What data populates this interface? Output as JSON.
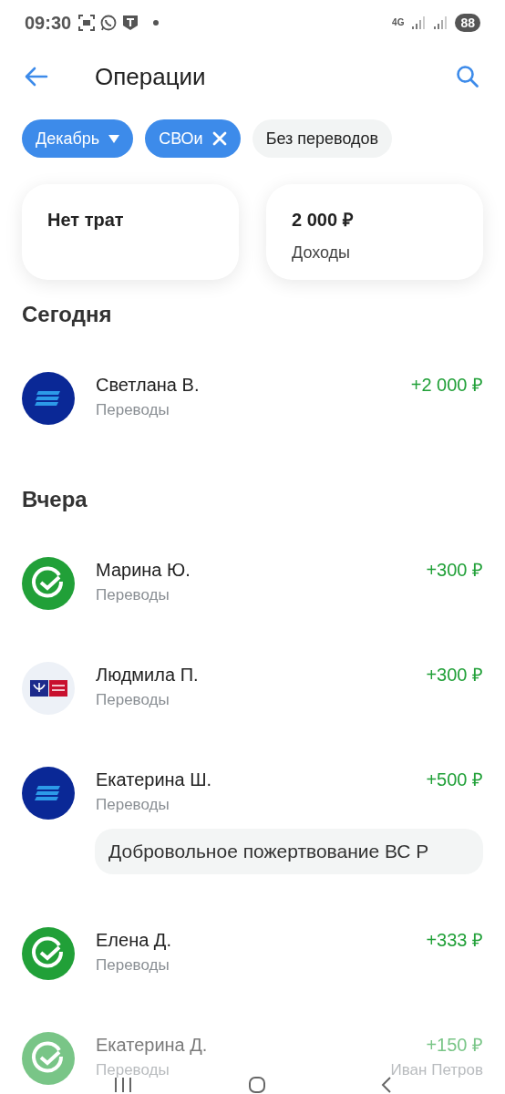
{
  "status_bar": {
    "time": "09:30",
    "network": "4G",
    "battery": "88"
  },
  "header": {
    "title": "Операции"
  },
  "filters": [
    {
      "label": "Декабрь",
      "kind": "dropdown",
      "selected": true
    },
    {
      "label": "СВОи",
      "kind": "removable",
      "selected": true
    },
    {
      "label": "Без переводов",
      "kind": "toggle",
      "selected": false
    }
  ],
  "summary": [
    {
      "value": "Нет трат"
    },
    {
      "value": "2 000 ₽",
      "caption": "Доходы"
    }
  ],
  "sections": [
    {
      "title": "Сегодня",
      "operations": [
        {
          "name": "Светлана В.",
          "category": "Переводы",
          "amount": "+2 000 ₽",
          "kind": "vtb",
          "faded": false
        }
      ]
    },
    {
      "title": "Вчера",
      "operations": [
        {
          "name": "Марина Ю.",
          "category": "Переводы",
          "amount": "+300 ₽",
          "kind": "sber",
          "faded": false
        },
        {
          "name": "Людмила П.",
          "category": "Переводы",
          "amount": "+300 ₽",
          "kind": "post",
          "faded": false
        },
        {
          "name": "Екатерина Ш.",
          "category": "Переводы",
          "amount": "+500 ₽",
          "kind": "vtb",
          "faded": false,
          "message": "Добровольное пожертвование ВС Р"
        },
        {
          "name": "Елена Д.",
          "category": "Переводы",
          "amount": "+333 ₽",
          "kind": "sber",
          "faded": false
        },
        {
          "name": "Екатерина Д.",
          "category": "Переводы",
          "amount": "+150 ₽",
          "kind": "sber",
          "faded": true,
          "note": "Иван Петров"
        }
      ]
    }
  ]
}
